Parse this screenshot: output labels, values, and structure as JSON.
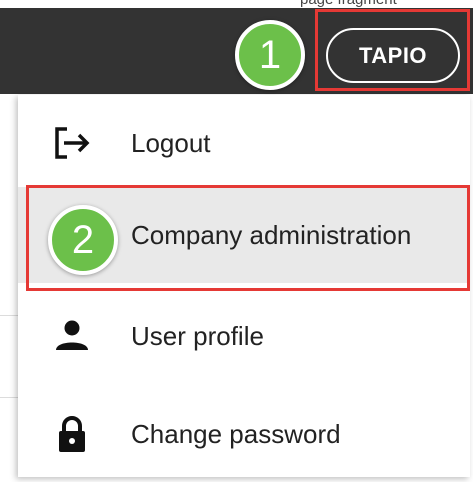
{
  "app_bar": {
    "user_button_label": "TAPIO",
    "top_strip_text": "page fragment"
  },
  "steps": [
    "1",
    "2"
  ],
  "menu": {
    "items": [
      {
        "label": "Logout",
        "icon": "logout-icon"
      },
      {
        "label": "Company administration",
        "icon": null
      },
      {
        "label": "User profile",
        "icon": "person-icon"
      },
      {
        "label": "Change password",
        "icon": "lock-icon"
      }
    ]
  },
  "colors": {
    "app_bar": "#333333",
    "highlight": "#e53935",
    "step_badge": "#6cc04a",
    "hover_row": "#e9e9e9"
  }
}
